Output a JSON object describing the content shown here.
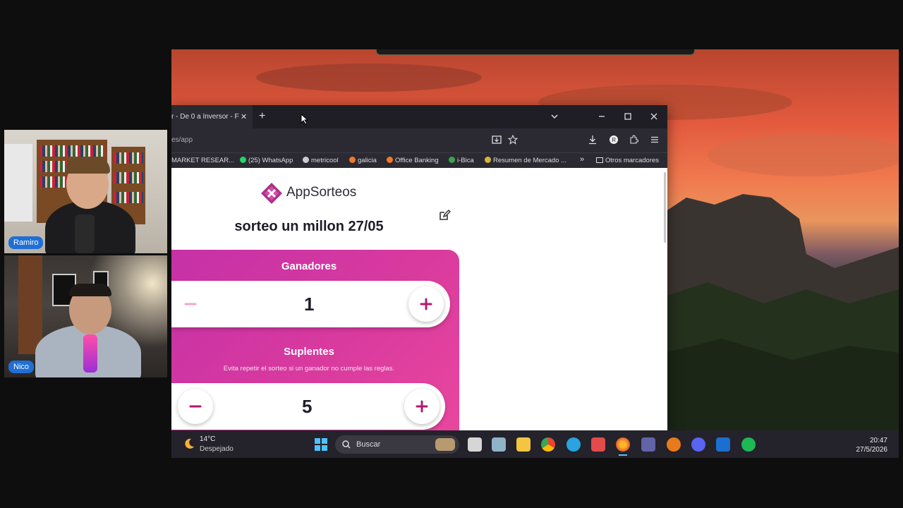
{
  "participants": [
    {
      "name": "Ramiro"
    },
    {
      "name": "Nico"
    }
  ],
  "browser": {
    "tab_title": "r - De 0 a Inversor - F",
    "tab_close": "✕",
    "new_tab": "+",
    "url": "es/app",
    "bookmarks": [
      {
        "label": "MARKET RESEAR..."
      },
      {
        "label": "(25) WhatsApp"
      },
      {
        "label": "metricool"
      },
      {
        "label": "galicia"
      },
      {
        "label": "Office Banking"
      },
      {
        "label": "i-Bica"
      },
      {
        "label": "Resumen de Mercado ..."
      },
      {
        "label": "Otros marcadores"
      }
    ]
  },
  "app": {
    "logo_text": "AppSorteos",
    "title": "sorteo un millon 27/05",
    "ganadores": {
      "label": "Ganadores",
      "value": "1"
    },
    "suplentes": {
      "label": "Suplentes",
      "help": "Evita repetir el sorteo si un ganador no cumple las reglas.",
      "value": "5"
    }
  },
  "taskbar": {
    "weather_temp": "14°C",
    "weather_condition": "Despejado",
    "search_placeholder": "Buscar",
    "time": "20:47",
    "date": "27/5/2026"
  },
  "colors": {
    "brand": "#d93a9e",
    "brand_dark": "#c531a8",
    "accent_icon": "#b3196f"
  }
}
